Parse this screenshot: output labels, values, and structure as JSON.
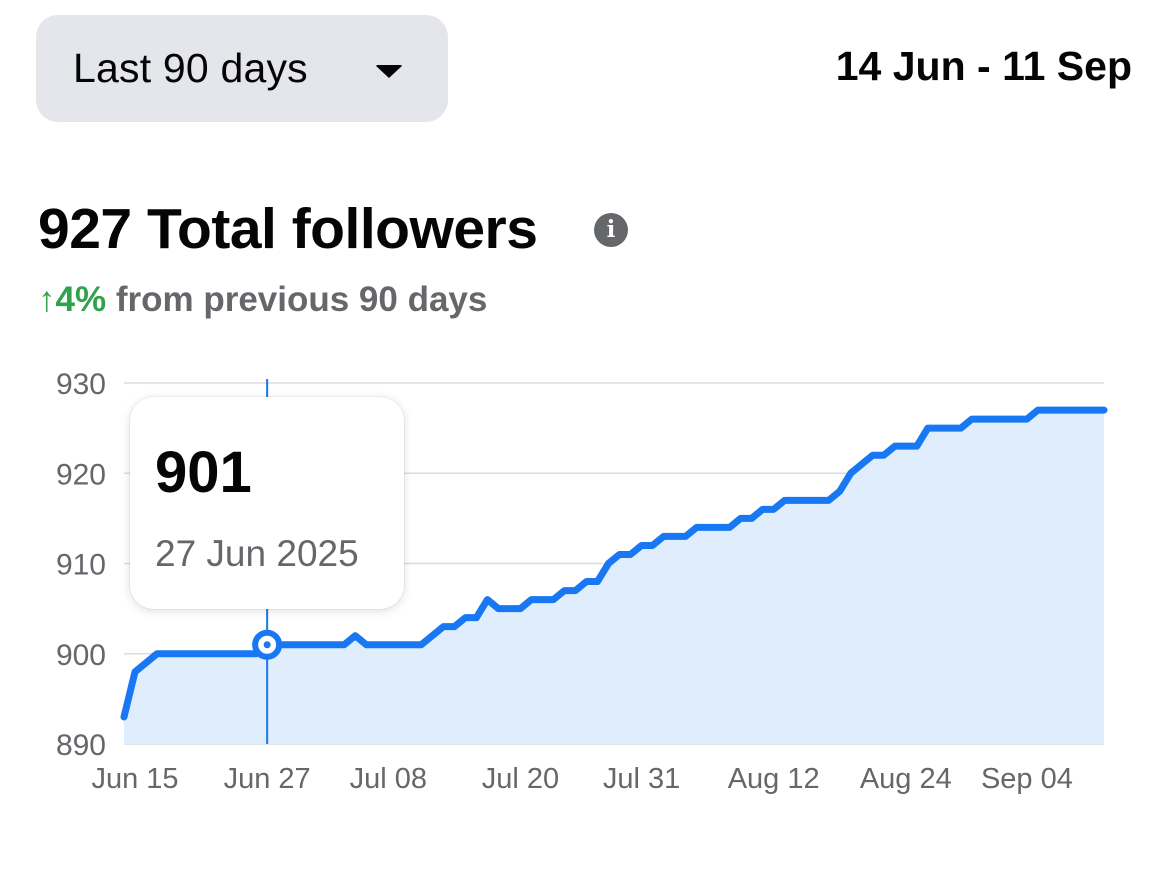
{
  "range_select": {
    "label": "Last 90 days",
    "icon": "caret-down-icon"
  },
  "date_range": "14 Jun - 11 Sep",
  "headline": "927 Total followers",
  "info_icon": "info-icon",
  "change": {
    "value": "↑4%",
    "text": "from previous 90 days",
    "color": "#31a24c"
  },
  "tooltip": {
    "value": "901",
    "date": "27 Jun 2025"
  },
  "colors": {
    "line": "#1877f2",
    "fill": "#e0edfc",
    "grid": "#dadde1",
    "axis_text": "#65676b"
  },
  "chart_data": {
    "type": "area",
    "ylim": [
      890,
      930
    ],
    "yticks": [
      930,
      920,
      910,
      900,
      890
    ],
    "xticks": [
      "Jun 15",
      "Jun 27",
      "Jul 08",
      "Jul 20",
      "Jul 31",
      "Aug 12",
      "Aug 24",
      "Sep 04"
    ],
    "grid": true,
    "highlight": {
      "date": "Jun 27",
      "value": 901
    },
    "series": [
      {
        "x": [
          "Jun 14",
          "Jun 15",
          "Jun 16",
          "Jun 17",
          "Jun 18",
          "Jun 19",
          "Jun 20",
          "Jun 21",
          "Jun 22",
          "Jun 23",
          "Jun 24",
          "Jun 25",
          "Jun 26",
          "Jun 27",
          "Jun 28",
          "Jun 29",
          "Jun 30",
          "Jul 01",
          "Jul 02",
          "Jul 03",
          "Jul 04",
          "Jul 05",
          "Jul 06",
          "Jul 07",
          "Jul 08",
          "Jul 09",
          "Jul 10",
          "Jul 11",
          "Jul 12",
          "Jul 13",
          "Jul 14",
          "Jul 15",
          "Jul 16",
          "Jul 17",
          "Jul 18",
          "Jul 19",
          "Jul 20",
          "Jul 21",
          "Jul 22",
          "Jul 23",
          "Jul 24",
          "Jul 25",
          "Jul 26",
          "Jul 27",
          "Jul 28",
          "Jul 29",
          "Jul 30",
          "Jul 31",
          "Aug 01",
          "Aug 02",
          "Aug 03",
          "Aug 04",
          "Aug 05",
          "Aug 06",
          "Aug 07",
          "Aug 08",
          "Aug 09",
          "Aug 10",
          "Aug 11",
          "Aug 12",
          "Aug 13",
          "Aug 14",
          "Aug 15",
          "Aug 16",
          "Aug 17",
          "Aug 18",
          "Aug 19",
          "Aug 20",
          "Aug 21",
          "Aug 22",
          "Aug 23",
          "Aug 24",
          "Aug 25",
          "Aug 26",
          "Aug 27",
          "Aug 28",
          "Aug 29",
          "Aug 30",
          "Aug 31",
          "Sep 01",
          "Sep 02",
          "Sep 03",
          "Sep 04",
          "Sep 05",
          "Sep 06",
          "Sep 07",
          "Sep 08",
          "Sep 09",
          "Sep 10",
          "Sep 11"
        ],
        "values": [
          893,
          898,
          899,
          900,
          900,
          900,
          900,
          900,
          900,
          900,
          900,
          900,
          900,
          901,
          901,
          901,
          901,
          901,
          901,
          901,
          901,
          902,
          901,
          901,
          901,
          901,
          901,
          901,
          902,
          903,
          903,
          904,
          904,
          906,
          905,
          905,
          905,
          906,
          906,
          906,
          907,
          907,
          908,
          908,
          910,
          911,
          911,
          912,
          912,
          913,
          913,
          913,
          914,
          914,
          914,
          914,
          915,
          915,
          916,
          916,
          917,
          917,
          917,
          917,
          917,
          918,
          920,
          921,
          922,
          922,
          923,
          923,
          923,
          925,
          925,
          925,
          925,
          926,
          926,
          926,
          926,
          926,
          926,
          927,
          927,
          927,
          927,
          927,
          927,
          927
        ]
      }
    ]
  }
}
